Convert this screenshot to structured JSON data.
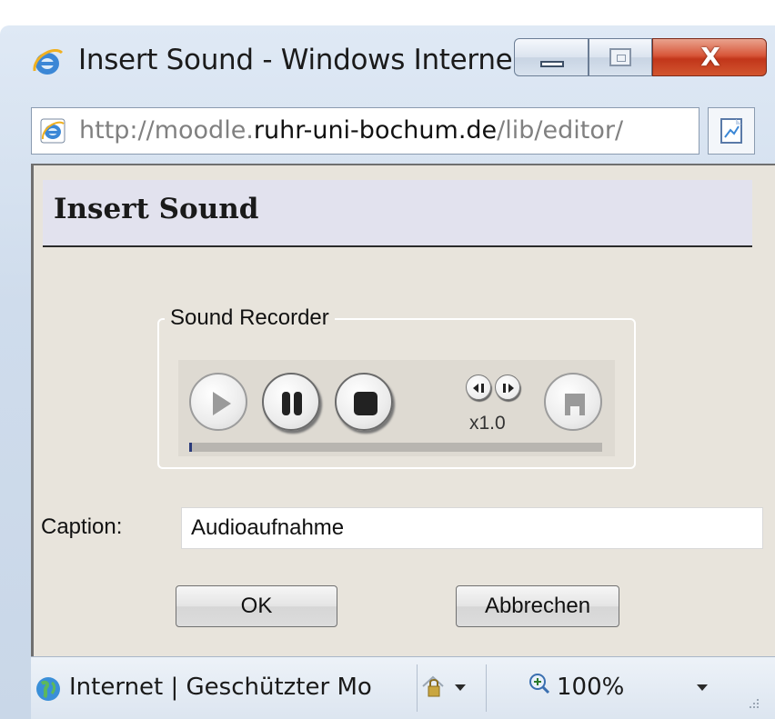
{
  "window": {
    "title": "Insert Sound - Windows Interne...",
    "close_label": "X",
    "address_prefix": "http://moodle.",
    "address_domain": "ruhr-uni-bochum.de",
    "address_path": "/lib/editor/"
  },
  "dialog": {
    "title": "Insert Sound",
    "recorder_legend": "Sound Recorder",
    "speed": "x1.0",
    "progress": 0.005,
    "caption_label": "Caption:",
    "caption_value": "Audioaufnahme",
    "ok_label": "OK",
    "cancel_label": "Abbrechen"
  },
  "statusbar": {
    "zone": "Internet | Geschützter Mo",
    "zoom": "100%"
  },
  "colors": {
    "dialog_bg": "#e8e4dc",
    "title_band": "#e2e2ee",
    "progress_fill": "#2a3a7a",
    "close_button": "#c2361a"
  },
  "icons": [
    "ie-logo-icon",
    "page-icon",
    "compatibility-view-icon",
    "play-icon",
    "pause-icon",
    "stop-icon",
    "slower-icon",
    "faster-icon",
    "save-icon",
    "globe-icon",
    "protected-mode-icon",
    "zoom-icon",
    "resize-grip-icon"
  ]
}
